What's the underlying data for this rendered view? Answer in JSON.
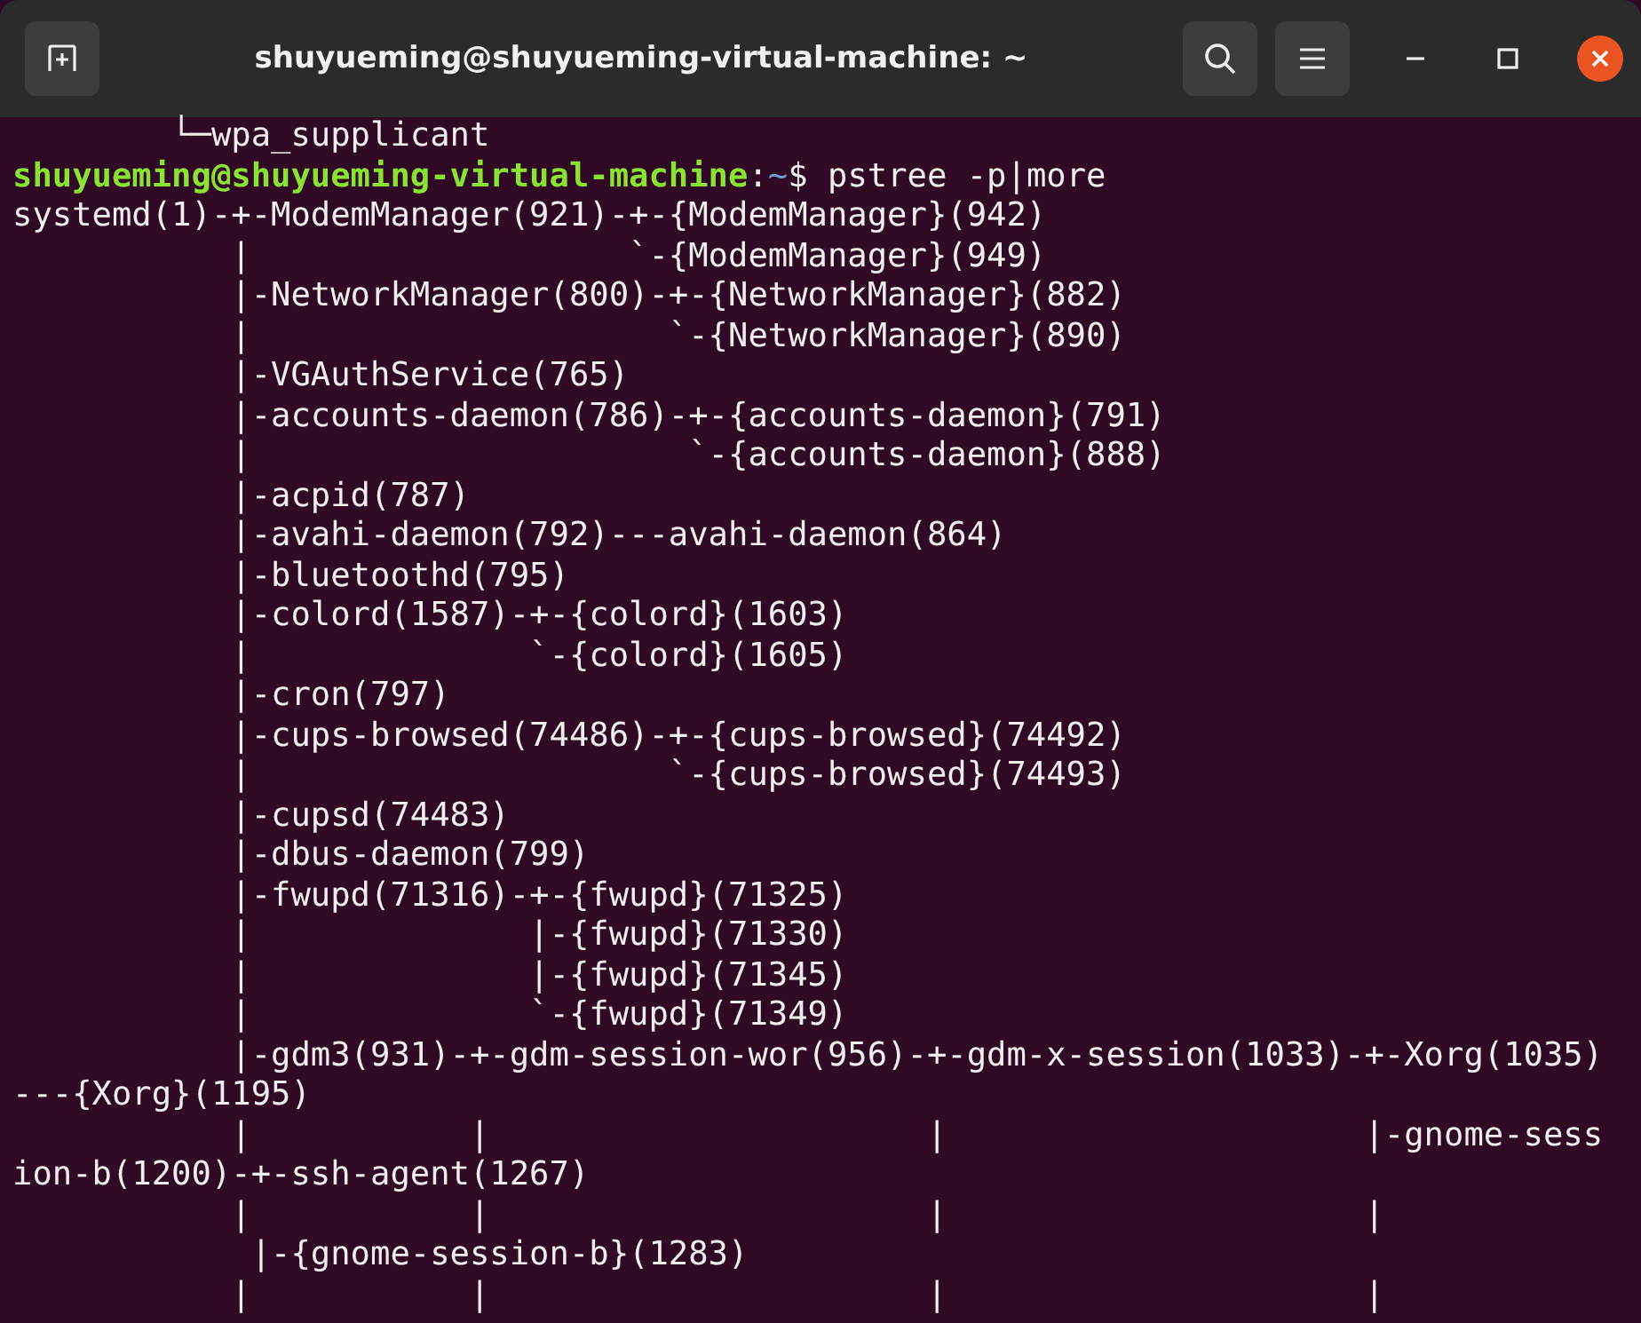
{
  "window": {
    "title": "shuyueming@shuyueming-virtual-machine: ~"
  },
  "terminal": {
    "lines_before": [
      "        └─wpa_supplicant"
    ],
    "prompt": {
      "user_host": "shuyueming@shuyueming-virtual-machine",
      "separator": ":",
      "path": "~",
      "command": "$ pstree -p|more"
    },
    "output": [
      "systemd(1)-+-ModemManager(921)-+-{ModemManager}(942)",
      "           |                   `-{ModemManager}(949)",
      "           |-NetworkManager(800)-+-{NetworkManager}(882)",
      "           |                     `-{NetworkManager}(890)",
      "           |-VGAuthService(765)",
      "           |-accounts-daemon(786)-+-{accounts-daemon}(791)",
      "           |                      `-{accounts-daemon}(888)",
      "           |-acpid(787)",
      "           |-avahi-daemon(792)---avahi-daemon(864)",
      "           |-bluetoothd(795)",
      "           |-colord(1587)-+-{colord}(1603)",
      "           |              `-{colord}(1605)",
      "           |-cron(797)",
      "           |-cups-browsed(74486)-+-{cups-browsed}(74492)",
      "           |                     `-{cups-browsed}(74493)",
      "           |-cupsd(74483)",
      "           |-dbus-daemon(799)",
      "           |-fwupd(71316)-+-{fwupd}(71325)",
      "           |              |-{fwupd}(71330)",
      "           |              |-{fwupd}(71345)",
      "           |              `-{fwupd}(71349)",
      "           |-gdm3(931)-+-gdm-session-wor(956)-+-gdm-x-session(1033)-+-Xorg(1035)",
      "---{Xorg}(1195)",
      "           |           |                      |                     |-gnome-sess",
      "ion-b(1200)-+-ssh-agent(1267)",
      "           |           |                      |                     |",
      "            |-{gnome-session-b}(1283)",
      "           |           |                      |                     |"
    ]
  }
}
